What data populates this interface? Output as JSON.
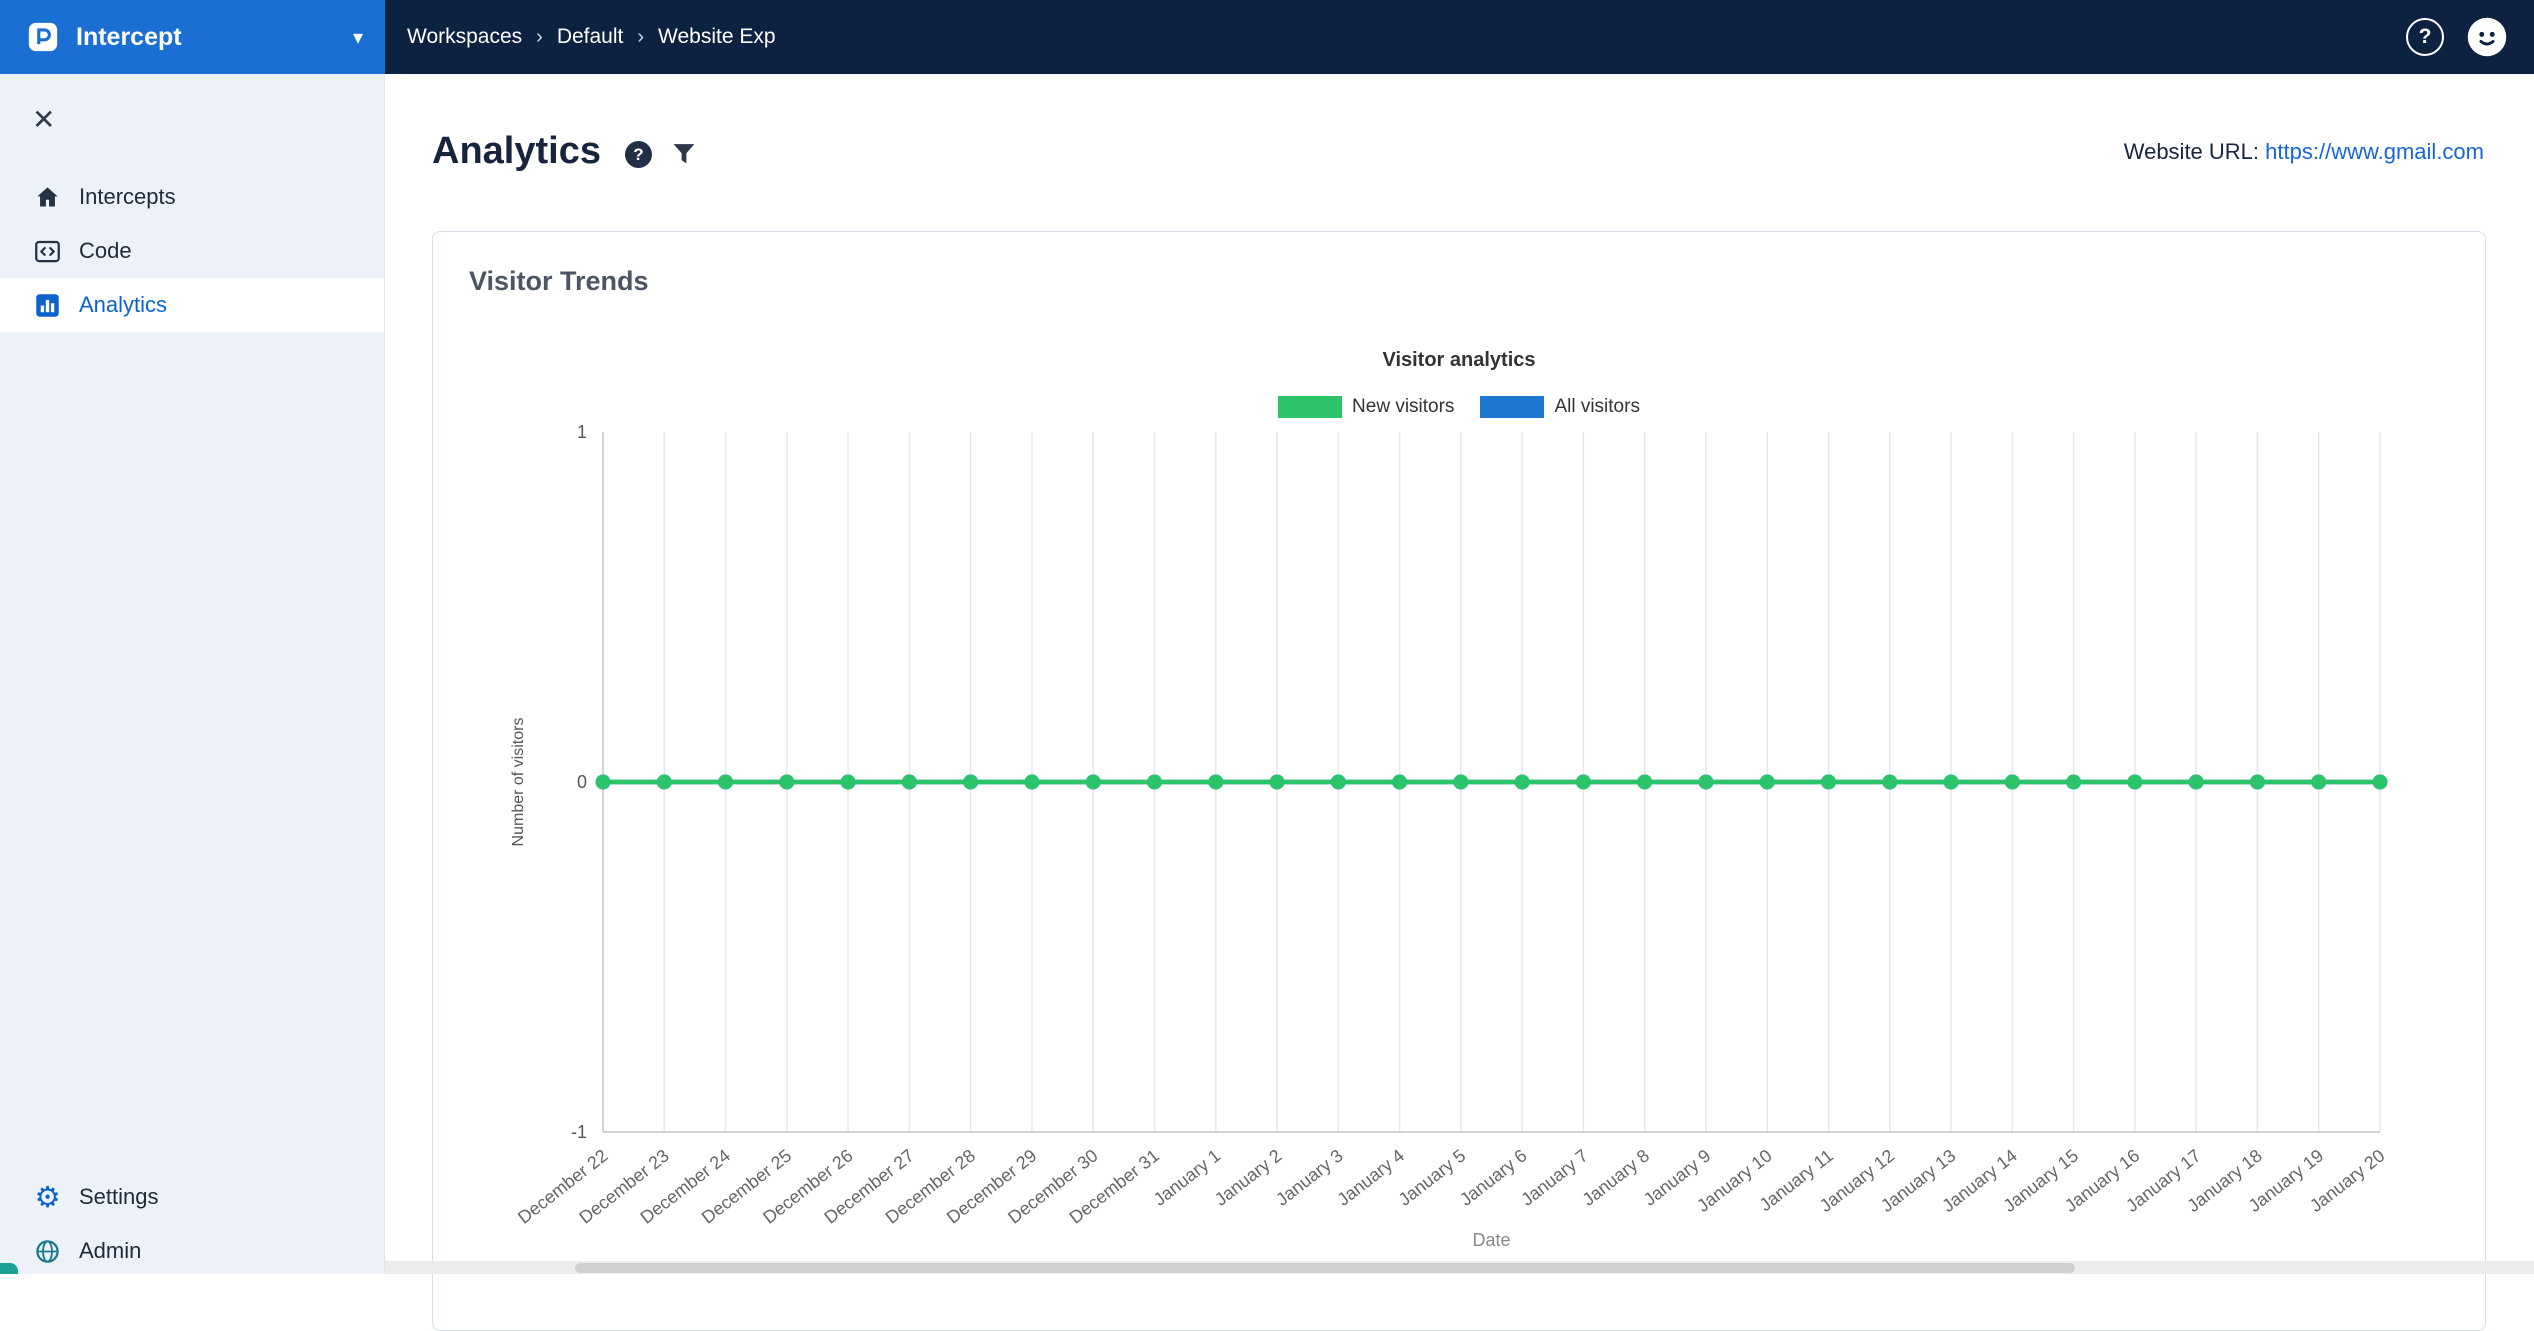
{
  "topbar": {
    "app_name": "Intercept",
    "breadcrumbs": [
      "Workspaces",
      "Default",
      "Website Exp"
    ],
    "help_icon": "question-mark-circle",
    "colors": {
      "bar": "#0d2240",
      "logo": "#1b6fd2"
    }
  },
  "sidebar": {
    "items": [
      {
        "label": "Intercepts",
        "icon": "home-icon",
        "active": false
      },
      {
        "label": "Code",
        "icon": "code-icon",
        "active": false
      },
      {
        "label": "Analytics",
        "icon": "bar-chart-icon",
        "active": true
      }
    ],
    "footer_items": [
      {
        "label": "Settings",
        "icon": "gear-icon"
      },
      {
        "label": "Admin",
        "icon": "globe-icon"
      }
    ],
    "accent_color": "#0b63ce"
  },
  "page": {
    "title": "Analytics",
    "info_icon": "?",
    "website_url_label": "Website URL:",
    "website_url": "https://www.gmail.com"
  },
  "card": {
    "title": "Visitor Trends"
  },
  "chart_data": {
    "type": "line",
    "title": "Visitor analytics",
    "xlabel": "Date",
    "ylabel": "Number of visitors",
    "ylim": [
      -1,
      1
    ],
    "yticks": [
      1,
      0,
      -1
    ],
    "grid": "vertical-only",
    "legend_position": "top",
    "categories": [
      "December 22",
      "December 23",
      "December 24",
      "December 25",
      "December 26",
      "December 27",
      "December 28",
      "December 29",
      "December 30",
      "December 31",
      "January 1",
      "January 2",
      "January 3",
      "January 4",
      "January 5",
      "January 6",
      "January 7",
      "January 8",
      "January 9",
      "January 10",
      "January 11",
      "January 12",
      "January 13",
      "January 14",
      "January 15",
      "January 16",
      "January 17",
      "January 18",
      "January 19",
      "January 20"
    ],
    "legend": [
      {
        "label": "New visitors",
        "color": "#2bc46a"
      },
      {
        "label": "All visitors",
        "color": "#1e78d2"
      }
    ],
    "series": [
      {
        "name": "All visitors",
        "color": "#1e78d2",
        "values": [
          0,
          0,
          0,
          0,
          0,
          0,
          0,
          0,
          0,
          0,
          0,
          0,
          0,
          0,
          0,
          0,
          0,
          0,
          0,
          0,
          0,
          0,
          0,
          0,
          0,
          0,
          0,
          0,
          0,
          0
        ]
      },
      {
        "name": "New visitors",
        "color": "#2bc46a",
        "values": [
          0,
          0,
          0,
          0,
          0,
          0,
          0,
          0,
          0,
          0,
          0,
          0,
          0,
          0,
          0,
          0,
          0,
          0,
          0,
          0,
          0,
          0,
          0,
          0,
          0,
          0,
          0,
          0,
          0,
          0
        ]
      }
    ]
  }
}
